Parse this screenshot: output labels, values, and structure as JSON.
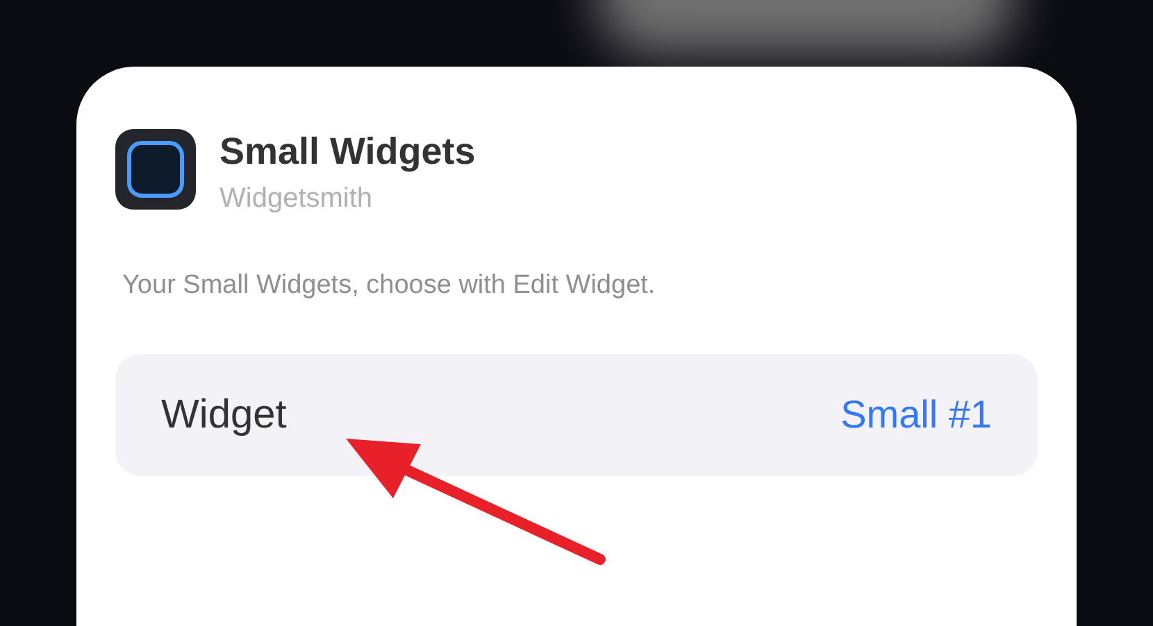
{
  "widget_card": {
    "title": "Small Widgets",
    "app_name": "Widgetsmith",
    "description": "Your Small Widgets, choose with Edit Widget.",
    "rows": [
      {
        "label": "Widget",
        "value": "Small #1"
      }
    ]
  },
  "annotation": {
    "kind": "arrow"
  }
}
